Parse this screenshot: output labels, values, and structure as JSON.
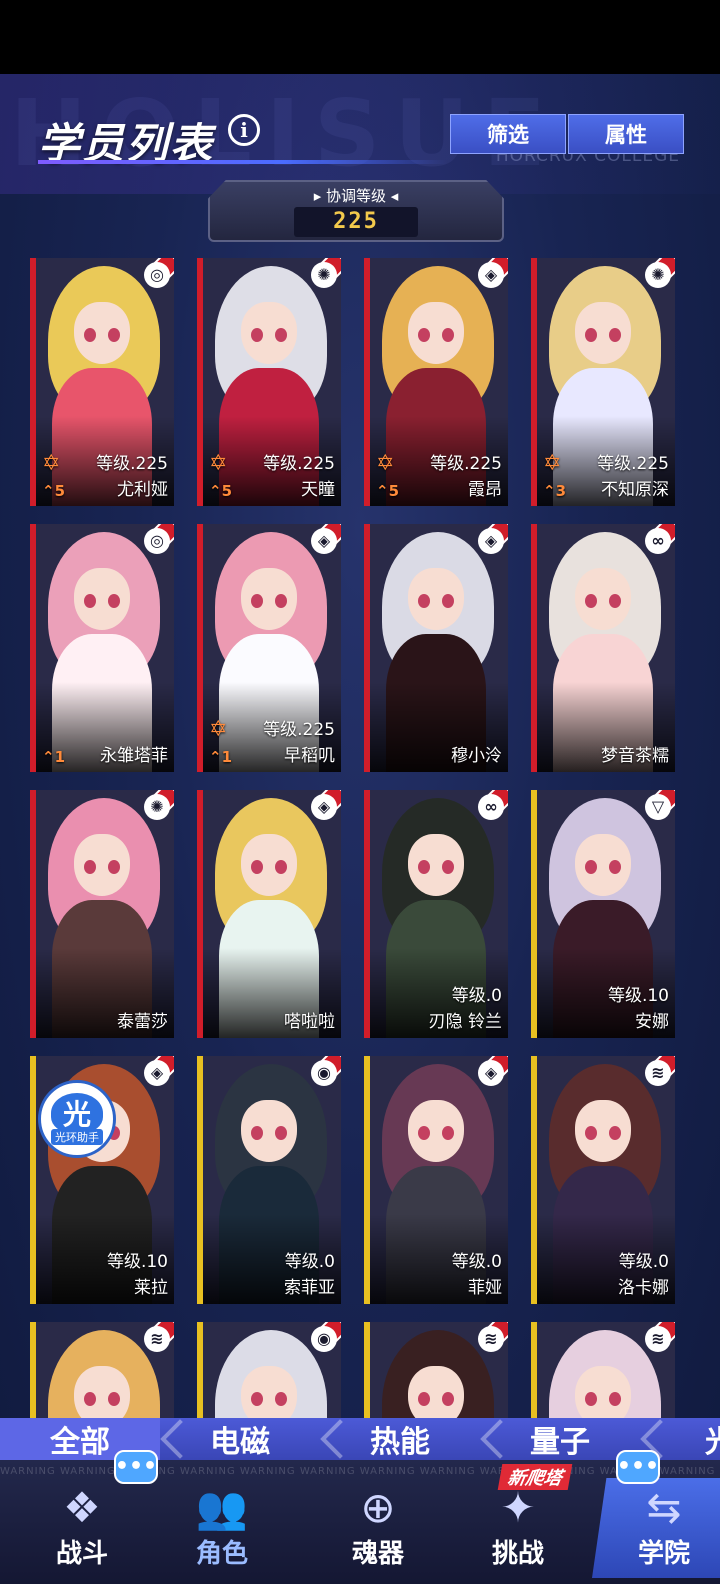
{
  "page": {
    "title": "学员列表",
    "info_icon": "info-icon",
    "bg_word": "HOLISUE",
    "bg_college": "HORCRUX COLLEGE"
  },
  "toolbar": {
    "filter_label": "筛选",
    "attribute_label": "属性"
  },
  "sync_level": {
    "label": "▸ 协调等级 ◂",
    "value": "225"
  },
  "characters": [
    {
      "name": "尤利娅",
      "level": "等级.225",
      "stars": "5",
      "element": "swirl-icon",
      "stripe": "red",
      "show_star": true
    },
    {
      "name": "天瞳",
      "level": "等级.225",
      "stars": "5",
      "element": "quantum-icon",
      "stripe": "red",
      "show_star": true
    },
    {
      "name": "霞昂",
      "level": "等级.225",
      "stars": "5",
      "element": "diamond-icon",
      "stripe": "red",
      "show_star": true
    },
    {
      "name": "不知原深",
      "level": "等级.225",
      "stars": "3",
      "element": "quantum-icon",
      "stripe": "red",
      "show_star": true
    },
    {
      "name": "永雏塔菲",
      "level": "",
      "stars": "1",
      "element": "swirl-icon",
      "stripe": "red",
      "show_star": false
    },
    {
      "name": "早稻叽",
      "level": "等级.225",
      "stars": "1",
      "element": "diamond-icon",
      "stripe": "red",
      "show_star": true
    },
    {
      "name": "穆小泠",
      "level": "",
      "stars": "",
      "element": "diamond-icon",
      "stripe": "red",
      "show_star": false
    },
    {
      "name": "梦音茶糯",
      "level": "",
      "stars": "",
      "element": "infinity-icon",
      "stripe": "red",
      "show_star": false
    },
    {
      "name": "泰蕾莎",
      "level": "",
      "stars": "",
      "element": "quantum-icon",
      "stripe": "red",
      "show_star": false
    },
    {
      "name": "嗒啦啦",
      "level": "",
      "stars": "",
      "element": "diamond-icon",
      "stripe": "red",
      "show_star": false
    },
    {
      "name": "刃隐 铃兰",
      "level": "等级.0",
      "stars": "",
      "element": "infinity-icon",
      "stripe": "red",
      "show_star": false
    },
    {
      "name": "安娜",
      "level": "等级.10",
      "stars": "",
      "element": "triangle-icon",
      "stripe": "gold",
      "show_star": false
    },
    {
      "name": "莱拉",
      "level": "等级.10",
      "stars": "",
      "element": "diamond-icon",
      "stripe": "gold",
      "show_star": false,
      "assist": true
    },
    {
      "name": "索菲亚",
      "level": "等级.0",
      "stars": "",
      "element": "drop-icon",
      "stripe": "gold",
      "show_star": false
    },
    {
      "name": "菲娅",
      "level": "等级.0",
      "stars": "",
      "element": "diamond-icon",
      "stripe": "gold",
      "show_star": false
    },
    {
      "name": "洛卡娜",
      "level": "等级.0",
      "stars": "",
      "element": "bars-icon",
      "stripe": "gold",
      "show_star": false
    },
    {
      "name": "",
      "level": "",
      "stars": "",
      "element": "bars-icon",
      "stripe": "gold",
      "show_star": false
    },
    {
      "name": "",
      "level": "",
      "stars": "",
      "element": "drop-icon",
      "stripe": "gold",
      "show_star": false
    },
    {
      "name": "",
      "level": "",
      "stars": "",
      "element": "bars-icon",
      "stripe": "gold",
      "show_star": false
    },
    {
      "name": "",
      "level": "",
      "stars": "",
      "element": "bars-icon",
      "stripe": "gold",
      "show_star": false
    }
  ],
  "assist_badge": {
    "glyph": "光",
    "label": "光环助手"
  },
  "filter_tabs": [
    {
      "label": "全部",
      "active": true
    },
    {
      "label": "电磁",
      "active": false
    },
    {
      "label": "热能",
      "active": false
    },
    {
      "label": "量子",
      "active": false
    },
    {
      "label": "光",
      "active": false
    }
  ],
  "bottom_nav": [
    {
      "label": "战斗",
      "icon": "map-icon",
      "glyph": "❖"
    },
    {
      "label": "角色",
      "icon": "people-icon",
      "glyph": "👥"
    },
    {
      "label": "魂器",
      "icon": "sphere-icon",
      "glyph": "⊕"
    },
    {
      "label": "挑战",
      "icon": "challenge-icon",
      "glyph": "✦"
    },
    {
      "label": "学院",
      "icon": "academy-icon",
      "glyph": "⇆"
    }
  ],
  "new_tag": "新爬塔",
  "warning_text": "WARNING WARNING WARNING WARNING WARNING WARNING WARNING WARNING WARNING WARNING WARNING WARNING",
  "colors": {
    "accent": "#4c5ad7",
    "stripe_red": "#d11d2a",
    "stripe_gold": "#e8c021",
    "level_value": "#f2c94c"
  }
}
